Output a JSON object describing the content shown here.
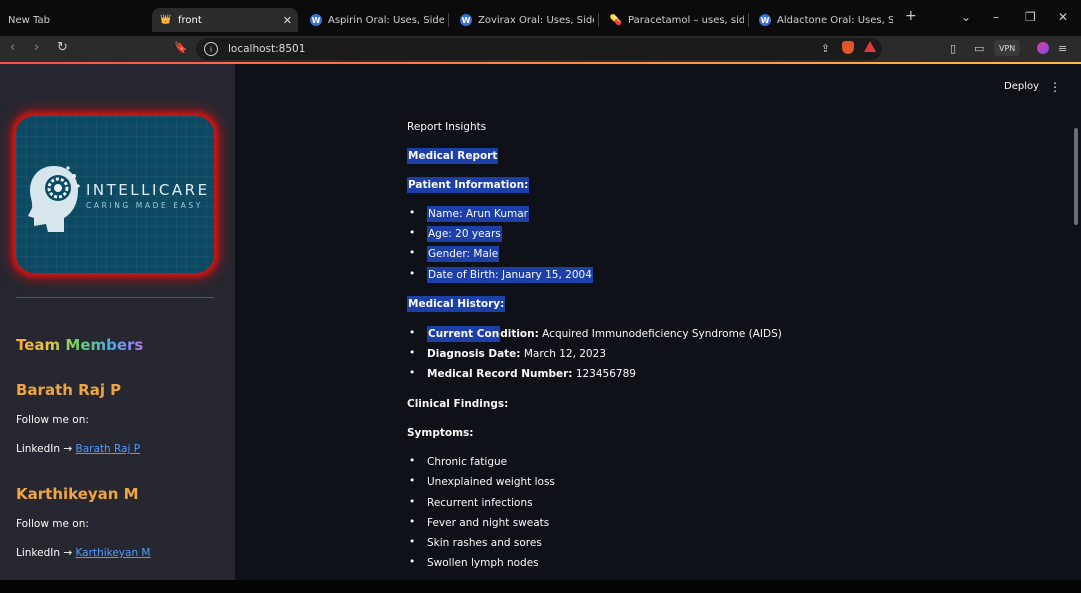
{
  "browser": {
    "tabs": [
      {
        "label": "New Tab",
        "favicon": "none"
      },
      {
        "label": "front",
        "favicon": "streamlit-icon",
        "active": true
      },
      {
        "label": "Aspirin Oral: Uses, Side Effects, I",
        "favicon": "w-icon"
      },
      {
        "label": "Zovirax Oral: Uses, Side Effects, I",
        "favicon": "w-icon"
      },
      {
        "label": "Paracetamol – uses, side effects",
        "favicon": "pill-icon"
      },
      {
        "label": "Aldactone Oral: Uses, Side Effec",
        "favicon": "w-icon"
      }
    ],
    "url": "localhost:8501",
    "vpn_label": "VPN"
  },
  "sidebar": {
    "logo": {
      "title": "INTELLICARE",
      "subtitle": "CARING MADE EASY"
    },
    "team_title": "Team Members",
    "members": [
      {
        "name": "Barath Raj P",
        "follow": "Follow me on:",
        "linkedin_prefix": "LinkedIn →",
        "link_text": "Barath Raj P"
      },
      {
        "name": "Karthikeyan M",
        "follow": "Follow me on:",
        "linkedin_prefix": "LinkedIn →",
        "link_text": "Karthikeyan M"
      }
    ]
  },
  "header": {
    "deploy_label": "Deploy"
  },
  "report": {
    "heading": "Report Insights",
    "title": "Medical Report",
    "patient_info_heading": "Patient Information:",
    "patient_info": [
      "Name: Arun Kumar",
      "Age: 20 years",
      "Gender: Male",
      "Date of Birth: January 15, 2004"
    ],
    "medical_history_heading": "Medical History:",
    "medical_history": [
      {
        "label_hl": "Current Con",
        "label_rest": "dition:",
        "value": "Acquired Immunodeficiency Syndrome (AIDS)"
      },
      {
        "label": "Diagnosis Date:",
        "value": "March 12, 2023"
      },
      {
        "label": "Medical Record Number:",
        "value": "123456789"
      }
    ],
    "clinical_findings_heading": "Clinical Findings:",
    "symptoms_heading": "Symptoms:",
    "symptoms": [
      "Chronic fatigue",
      "Unexplained weight loss",
      "Recurrent infections",
      "Fever and night sweats",
      "Skin rashes and sores",
      "Swollen lymph nodes"
    ]
  },
  "colors": {
    "sidebar_bg": "#262730",
    "main_bg": "#0e1117",
    "highlight": "#1c3fa8",
    "member_name": "#f1a53c",
    "link": "#4f9dff",
    "logo_glow": "#d21414"
  }
}
